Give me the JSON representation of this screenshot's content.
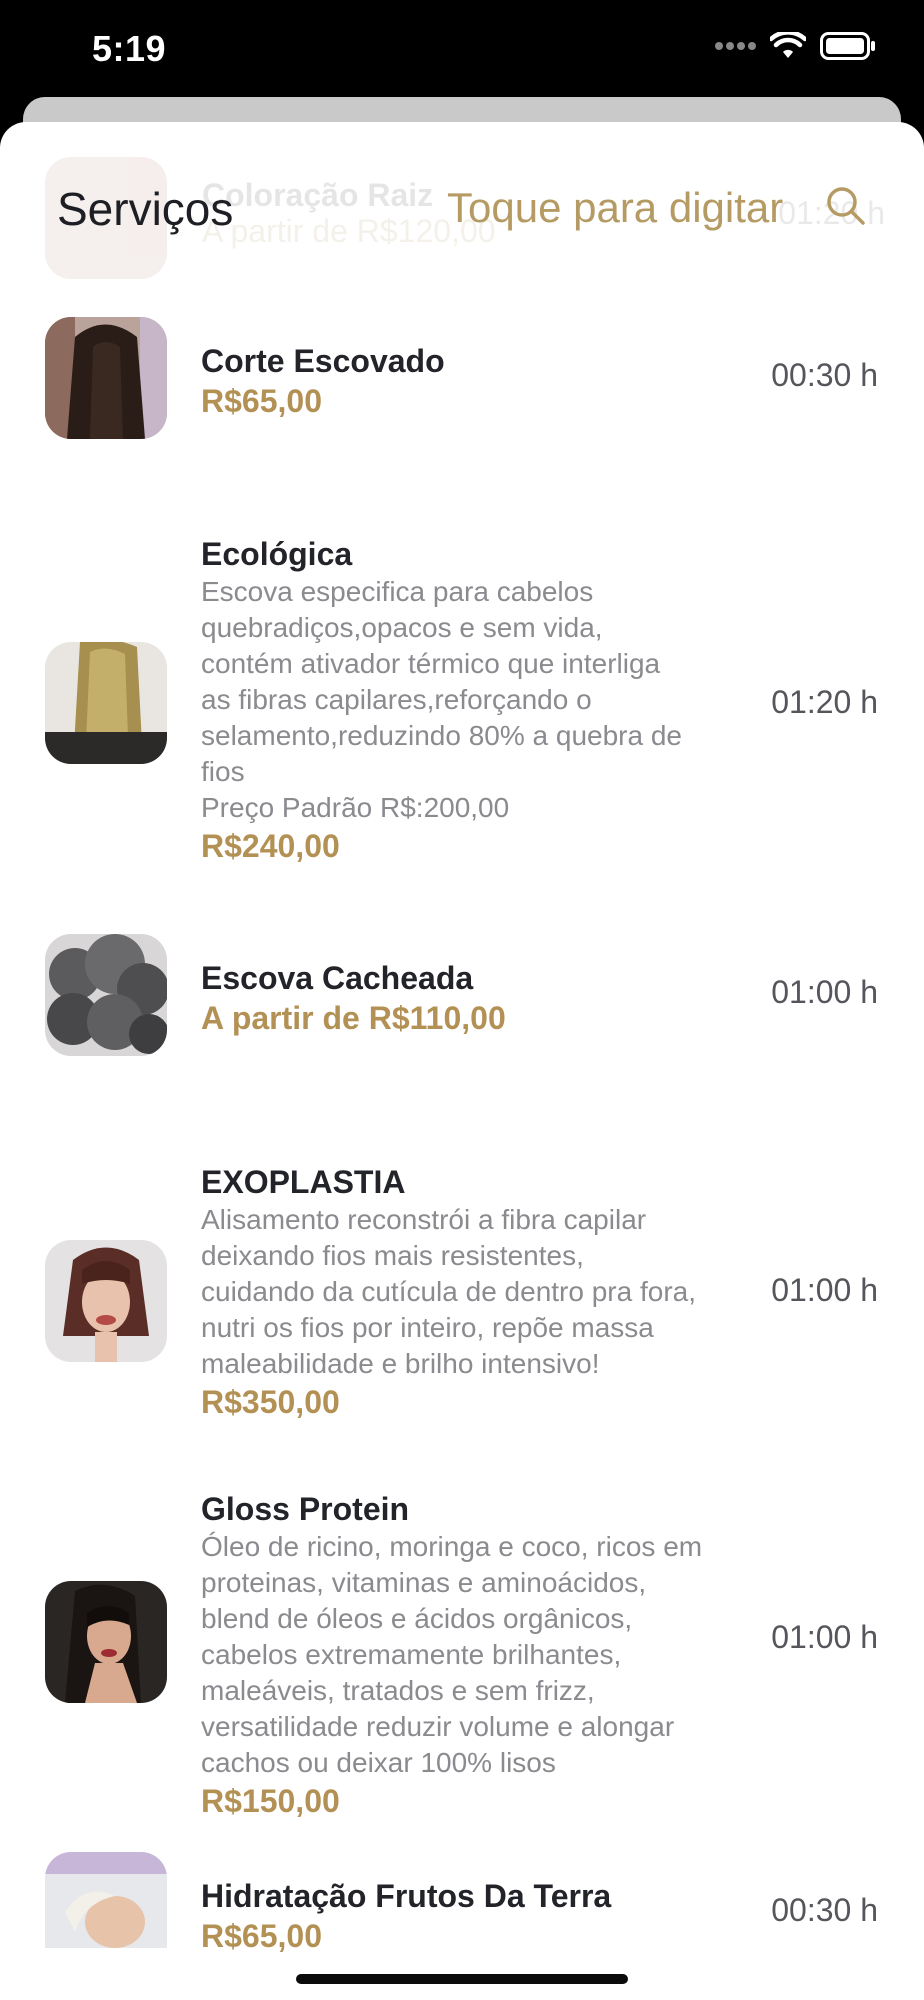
{
  "status_bar": {
    "time": "5:19"
  },
  "header": {
    "title": "Serviços",
    "search_prompt": "Toque para digitar",
    "icon": "search-icon"
  },
  "ghost_item": {
    "name": "Coloração  Raiz",
    "price": "A partir de R$120,00",
    "duration": "01:20 h"
  },
  "services": [
    {
      "name": "Corte Escovado",
      "description": [],
      "price": "R$65,00",
      "duration": "00:30 h"
    },
    {
      "name": "Ecológica",
      "description": [
        "Escova especifica para cabelos",
        "quebradiços,opacos e sem vida,",
        "contém ativador térmico que interliga",
        "as fibras capilares,reforçando o",
        "selamento,reduzindo 80% a quebra de",
        "fios",
        "Preço Padrão R$:200,00"
      ],
      "price": "R$240,00",
      "duration": "01:20 h"
    },
    {
      "name": "Escova Cacheada",
      "description": [],
      "price": "A partir de R$110,00",
      "duration": "01:00 h"
    },
    {
      "name": "EXOPLASTIA",
      "description": [
        "Alisamento reconstrói a fibra capilar",
        "deixando fios mais resistentes,",
        "cuidando da cutícula de dentro pra fora,",
        "nutri os fios por inteiro, repõe massa",
        "maleabilidade e brilho intensivo!"
      ],
      "price": "R$350,00",
      "duration": "01:00 h"
    },
    {
      "name": "Gloss Protein",
      "description": [
        "Óleo de ricino, moringa e coco, ricos em",
        "proteinas, vitaminas e aminoácidos,",
        "blend de óleos e ácidos orgânicos,",
        "cabelos extremamente brilhantes,",
        "maleáveis, tratados e sem frizz,",
        "versatilidade reduzir volume e alongar",
        "cachos ou deixar 100% lisos"
      ],
      "price": "R$150,00",
      "duration": "01:00 h"
    },
    {
      "name": "Hidratação Frutos Da Terra",
      "description": [],
      "price": "R$65,00",
      "duration": "00:30 h"
    }
  ],
  "colors": {
    "accent": "#b39155",
    "title": "#1e1f24",
    "muted": "#8a8a8f"
  }
}
